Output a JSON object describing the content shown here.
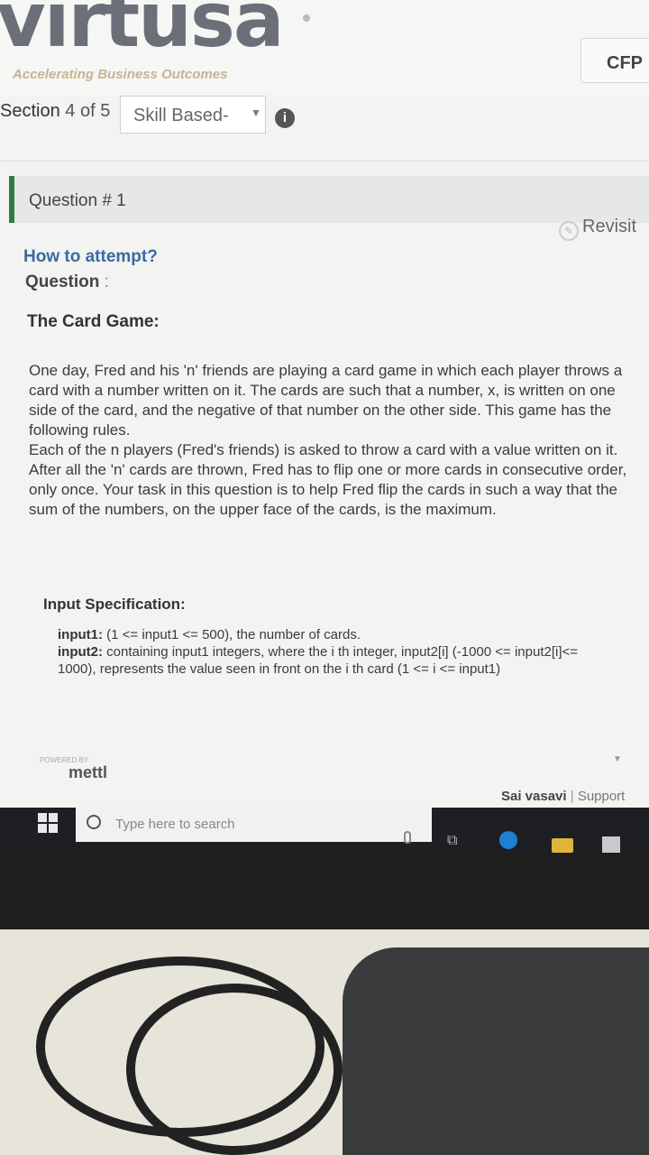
{
  "brand": {
    "logo": "virtusa",
    "tagline": "Accelerating Business Outcomes"
  },
  "header": {
    "cfp_label": "CFP"
  },
  "section": {
    "label": "Section",
    "current": "4",
    "of": "of",
    "total": "5",
    "dropdown_value": "Skill Based",
    "dropdown_suffix": "-"
  },
  "question": {
    "title": "Question # 1",
    "revisit_label": "Revisit",
    "how_to_attempt": "How to attempt?",
    "question_label": "Question",
    "question_colon": ":",
    "card_title": "The Card Game:",
    "paragraph1": "One day, Fred and his 'n' friends are playing a card game in which each player throws a card with a number written on it. The cards are such that a number, x, is written on one side of the card, and the negative of that number on the other side. This game has the following rules.",
    "paragraph2": "Each of the n players (Fred's friends) is asked to throw a card with a value written on it. After all the 'n' cards are thrown, Fred has to flip one or more cards in consecutive order, only once. Your task in this question is to help Fred flip the cards in such a way that the sum of the numbers, on the upper face of the cards, is the maximum.",
    "input_spec_heading": "Input Specification:",
    "input1_label": "input1:",
    "input1_text": "(1 <= input1 <= 500), the number of cards.",
    "input2_label": "input2:",
    "input2_text": "containing input1 integers, where the i th integer, input2[i] (-1000 <= input2[i]<= 1000), represents the value seen in front on the i th card (1 <= i <= input1)"
  },
  "footer": {
    "powered_by": "POWERED BY",
    "mettl_logo": "mettl",
    "user_name": "Sai vasavi",
    "separator": "|",
    "support_label": "Support"
  },
  "taskbar": {
    "search_placeholder": "Type here to search"
  },
  "icons": [
    "info-icon",
    "chevron-down-icon",
    "revisit-icon",
    "windows-start-icon",
    "search-icon",
    "microphone-icon",
    "task-view-icon",
    "edge-browser-icon",
    "file-explorer-icon",
    "store-icon"
  ]
}
